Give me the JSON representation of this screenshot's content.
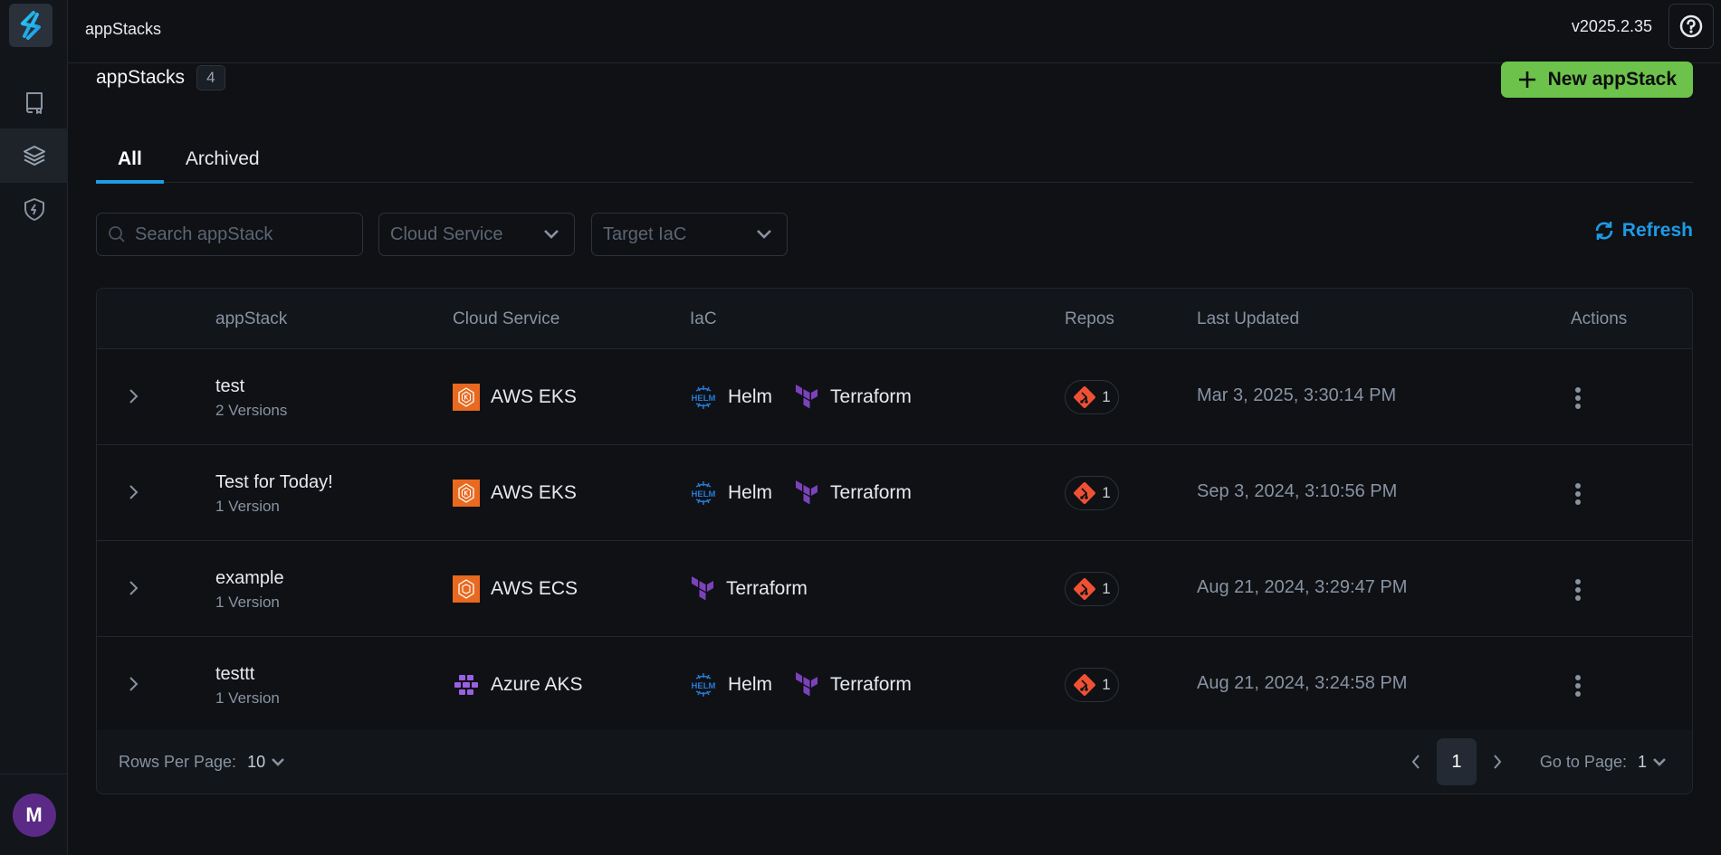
{
  "app": {
    "title": "appStacks",
    "version": "v2025.2.35",
    "user_initial": "M"
  },
  "sidebar": {
    "items": [
      {
        "name": "docs",
        "icon": "book-icon"
      },
      {
        "name": "appstacks",
        "icon": "layers-icon",
        "active": true
      },
      {
        "name": "security",
        "icon": "shield-bolt-icon"
      }
    ]
  },
  "page": {
    "title": "appStacks",
    "count": "4",
    "new_button": "New appStack",
    "tabs": [
      {
        "label": "All",
        "active": true
      },
      {
        "label": "Archived",
        "active": false
      }
    ],
    "search_placeholder": "Search appStack",
    "cloud_filter": "Cloud Service",
    "iac_filter": "Target IaC",
    "refresh_label": "Refresh"
  },
  "table": {
    "columns": [
      "appStack",
      "Cloud Service",
      "IaC",
      "Repos",
      "Last Updated",
      "Actions"
    ],
    "rows": [
      {
        "name": "test",
        "versions": "2 Versions",
        "cloud": "AWS EKS",
        "cloud_icon": "aws-eks-icon",
        "iac": [
          "Helm",
          "Terraform"
        ],
        "repos": "1",
        "updated": "Mar 3, 2025, 3:30:14 PM"
      },
      {
        "name": "Test for Today!",
        "versions": "1 Version",
        "cloud": "AWS EKS",
        "cloud_icon": "aws-eks-icon",
        "iac": [
          "Helm",
          "Terraform"
        ],
        "repos": "1",
        "updated": "Sep 3, 2024, 3:10:56 PM"
      },
      {
        "name": "example",
        "versions": "1 Version",
        "cloud": "AWS ECS",
        "cloud_icon": "aws-ecs-icon",
        "iac": [
          "Terraform"
        ],
        "repos": "1",
        "updated": "Aug 21, 2024, 3:29:47 PM"
      },
      {
        "name": "testtt",
        "versions": "1 Version",
        "cloud": "Azure AKS",
        "cloud_icon": "azure-aks-icon",
        "iac": [
          "Helm",
          "Terraform"
        ],
        "repos": "1",
        "updated": "Aug 21, 2024, 3:24:58 PM"
      }
    ]
  },
  "footer": {
    "rows_per_page_label": "Rows Per Page:",
    "rows_per_page": "10",
    "current_page": "1",
    "go_to_page_label": "Go to Page:",
    "go_to_page": "1"
  },
  "colors": {
    "accent": "#1e9be6",
    "primary_button": "#6cc24a",
    "aws_orange": "#e8691f",
    "terraform_purple": "#7b42bc",
    "helm_blue": "#277ad6",
    "git_red": "#f05033",
    "avatar": "#5b2a86"
  }
}
